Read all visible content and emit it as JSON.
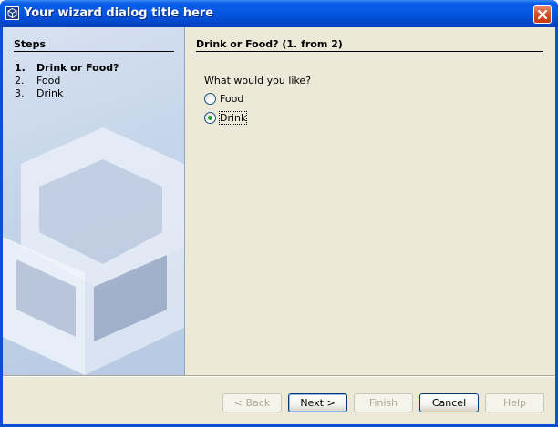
{
  "window": {
    "title": "Your wizard dialog title here",
    "icon": "wizard-cube-icon",
    "close_icon": "close-icon"
  },
  "steps": {
    "heading": "Steps",
    "items": [
      {
        "num": "1.",
        "label": "Drink or Food?",
        "current": true
      },
      {
        "num": "2.",
        "label": "Food",
        "current": false
      },
      {
        "num": "3.",
        "label": "Drink",
        "current": false
      }
    ]
  },
  "content": {
    "title": "Drink or Food? (1. from 2)",
    "question": "What would you like?",
    "options": [
      {
        "label": "Food",
        "selected": false
      },
      {
        "label": "Drink",
        "selected": true
      }
    ]
  },
  "buttons": {
    "back": "< Back",
    "next": "Next >",
    "finish": "Finish",
    "cancel": "Cancel",
    "help": "Help"
  },
  "colors": {
    "title_bar": "#0655e0",
    "client_bg": "#ece9d8",
    "radio_dot": "#21a121",
    "close_button": "#d6502c"
  }
}
